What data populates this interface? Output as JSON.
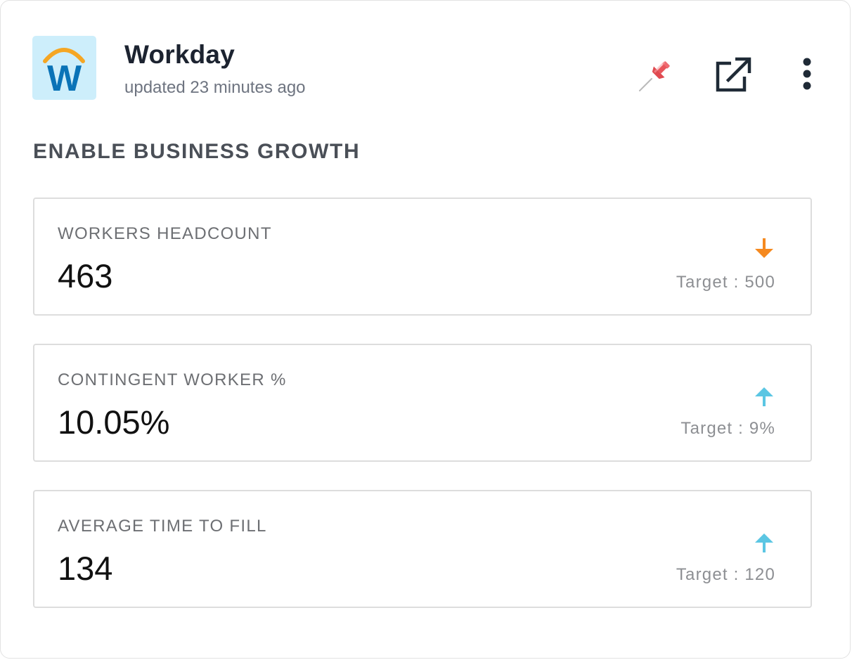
{
  "header": {
    "app_name": "Workday",
    "updated": "updated 23 minutes ago",
    "logo_letter": "W",
    "icons": {
      "pin": "pushpin-icon",
      "open": "external-link-icon",
      "more": "more-vertical-icon"
    }
  },
  "section": {
    "title": "ENABLE BUSINESS GROWTH"
  },
  "metrics": [
    {
      "label": "WORKERS HEADCOUNT",
      "value": "463",
      "target": "Target : 500",
      "trend": "down",
      "trend_color": "#f5891f"
    },
    {
      "label": "CONTINGENT WORKER %",
      "value": "10.05%",
      "target": "Target : 9%",
      "trend": "up",
      "trend_color": "#5bc6e3"
    },
    {
      "label": "AVERAGE TIME TO FILL",
      "value": "134",
      "target": "Target : 120",
      "trend": "up",
      "trend_color": "#5bc6e3"
    }
  ],
  "colors": {
    "logo_bg": "#cdeefb",
    "logo_arc": "#f5a623",
    "logo_letter": "#0a73b7",
    "pin": "#e8555b"
  }
}
